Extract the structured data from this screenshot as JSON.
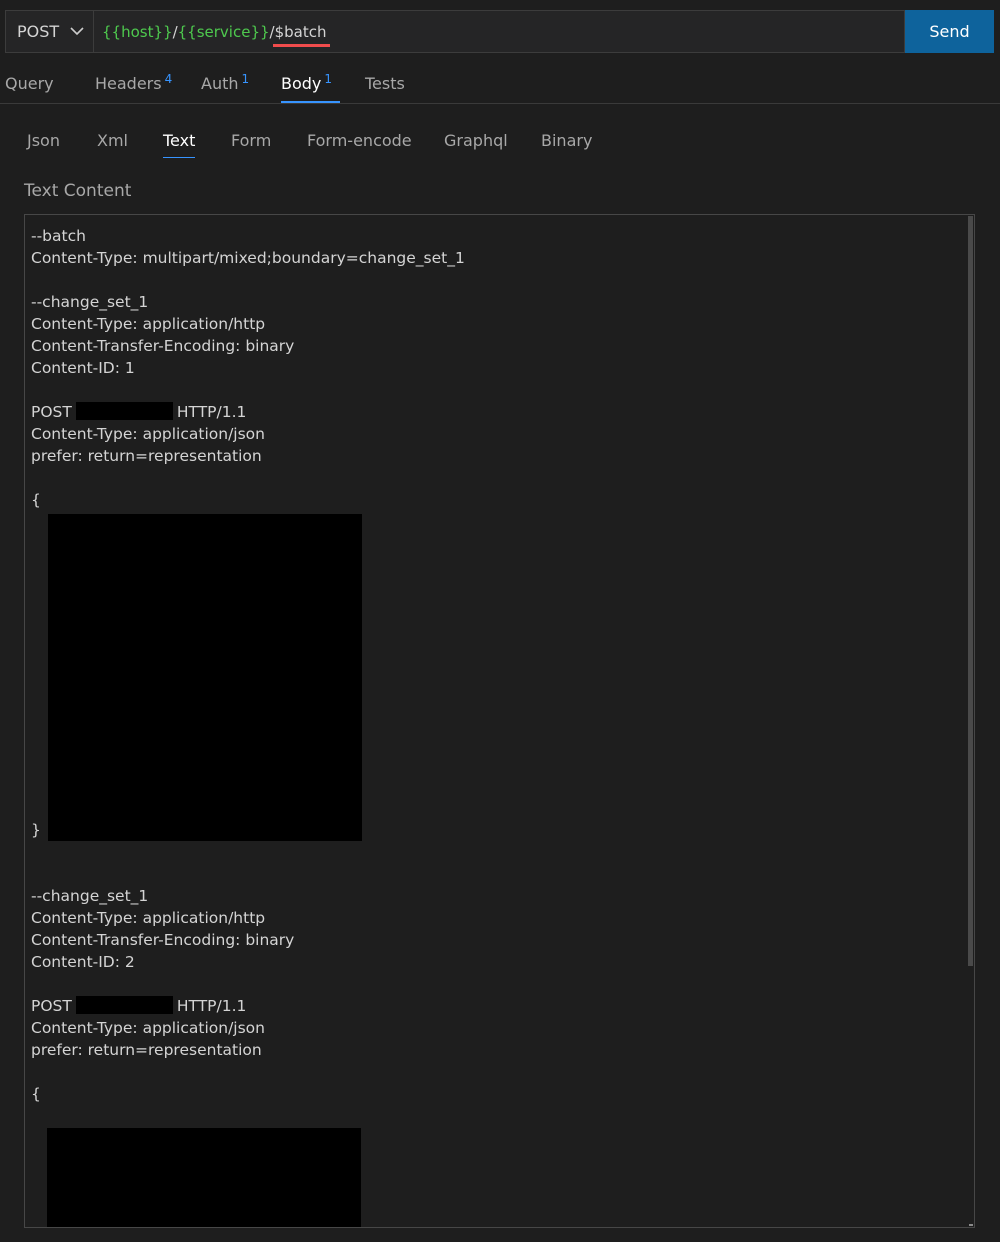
{
  "request": {
    "method": "POST",
    "url": {
      "host_var": "{{host}}",
      "slash1": "/",
      "service_var": "{{service}}",
      "slash2": "/",
      "path": "$batch"
    },
    "send_label": "Send"
  },
  "tabs": [
    {
      "label": "Query",
      "badge": ""
    },
    {
      "label": "Headers",
      "badge": "4"
    },
    {
      "label": "Auth",
      "badge": "1"
    },
    {
      "label": "Body",
      "badge": "1"
    },
    {
      "label": "Tests",
      "badge": ""
    }
  ],
  "active_tab": "Body",
  "body_tabs": [
    "Json",
    "Xml",
    "Text",
    "Form",
    "Form-encode",
    "Graphql",
    "Binary"
  ],
  "active_body_tab": "Text",
  "content_label": "Text Content",
  "text_content": {
    "lines": [
      "--batch",
      "Content-Type: multipart/mixed;boundary=change_set_1",
      "",
      "--change_set_1",
      "Content-Type: application/http",
      "Content-Transfer-Encoding: binary",
      "Content-ID: 1",
      "",
      "POST",
      "Content-Type: application/json",
      "prefer: return=representation",
      "",
      "{",
      "",
      "",
      "",
      "",
      "",
      "",
      "",
      "",
      "",
      "",
      "",
      "",
      "",
      "",
      "}",
      "",
      "",
      "--change_set_1",
      "Content-Type: application/http",
      "Content-Transfer-Encoding: binary",
      "Content-ID: 2",
      "",
      "POST",
      "Content-Type: application/json",
      "prefer: return=representation",
      "",
      "{"
    ],
    "post_suffix": "HTTP/1.1"
  },
  "colors": {
    "background": "#1e1e1e",
    "accent": "#3794ff",
    "send_button": "#0e639c",
    "variable": "#4ec94e",
    "error_underline": "#f14c4c"
  }
}
